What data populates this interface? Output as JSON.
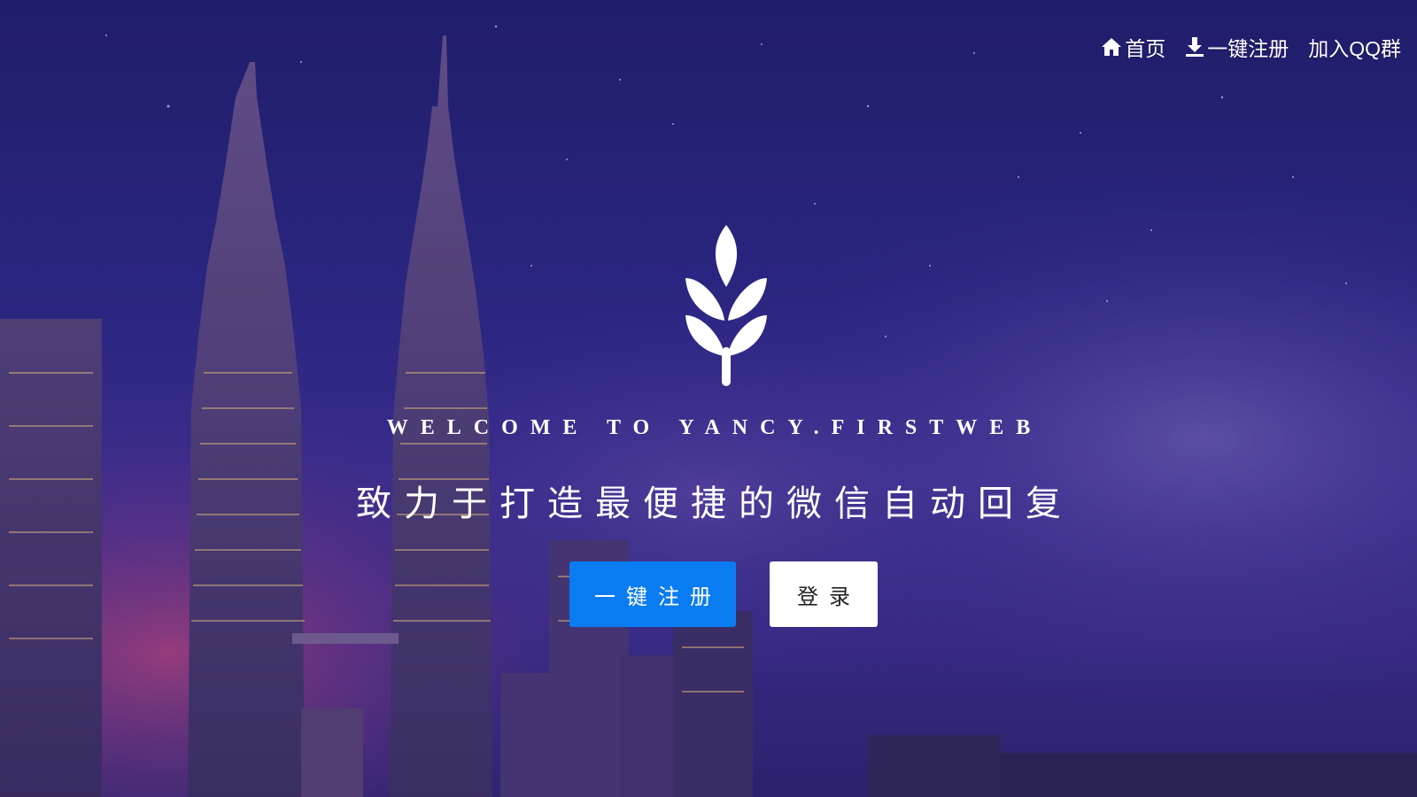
{
  "nav": {
    "home": {
      "label": "首页",
      "icon": "home-icon"
    },
    "register": {
      "label": "一键注册",
      "icon": "download-icon"
    },
    "qq_group": {
      "label": "加入QQ群"
    }
  },
  "hero": {
    "logo_icon": "wheat-leaf-icon",
    "welcome": "WELCOME TO YANCY.FIRSTWEB",
    "slogan": "致力于打造最便捷的微信自动回复",
    "register_button": "一键注册",
    "login_button": "登录"
  },
  "colors": {
    "primary": "#0a7cf2",
    "background_top": "#1e1c66",
    "background_bottom": "#3a2a86"
  }
}
